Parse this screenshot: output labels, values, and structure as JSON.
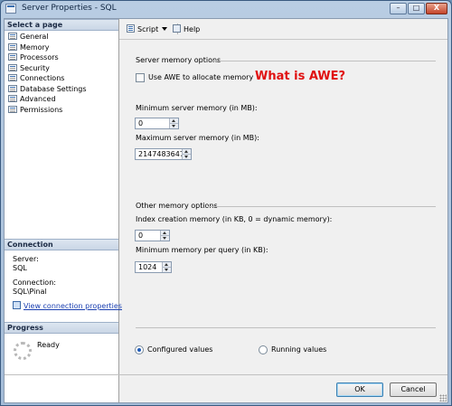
{
  "window": {
    "title": "Server Properties - SQL",
    "controls": {
      "minimize": "–",
      "maximize": "□",
      "close": "X"
    }
  },
  "left_pane": {
    "select_page": {
      "heading": "Select a page",
      "items": [
        "General",
        "Memory",
        "Processors",
        "Security",
        "Connections",
        "Database Settings",
        "Advanced",
        "Permissions"
      ]
    },
    "connection": {
      "heading": "Connection",
      "server_label": "Server:",
      "server_value": "SQL",
      "connection_label": "Connection:",
      "connection_value": "SQL\\Pinal",
      "view_link": "View connection properties"
    },
    "progress": {
      "heading": "Progress",
      "status": "Ready"
    }
  },
  "toolbar": {
    "script_label": "Script",
    "help_label": "Help"
  },
  "server_memory": {
    "group_label": "Server memory options",
    "awe_checkbox_label": "Use AWE to allocate memory",
    "awe_checked": false,
    "min_label": "Minimum server memory (in MB):",
    "min_value": "0",
    "max_label": "Maximum server memory (in MB):",
    "max_value": "2147483647"
  },
  "annotation": "What is AWE?",
  "other_memory": {
    "group_label": "Other memory options",
    "index_label": "Index creation memory (in KB, 0 = dynamic memory):",
    "index_value": "0",
    "query_label": "Minimum memory per query (in KB):",
    "query_value": "1024"
  },
  "values_mode": {
    "configured_label": "Configured values",
    "running_label": "Running values",
    "selected": "configured"
  },
  "buttons": {
    "ok": "OK",
    "cancel": "Cancel"
  },
  "colors": {
    "annotation": "#e01010",
    "link": "#1a3fb0",
    "title_bar": "#a4bcd8"
  }
}
